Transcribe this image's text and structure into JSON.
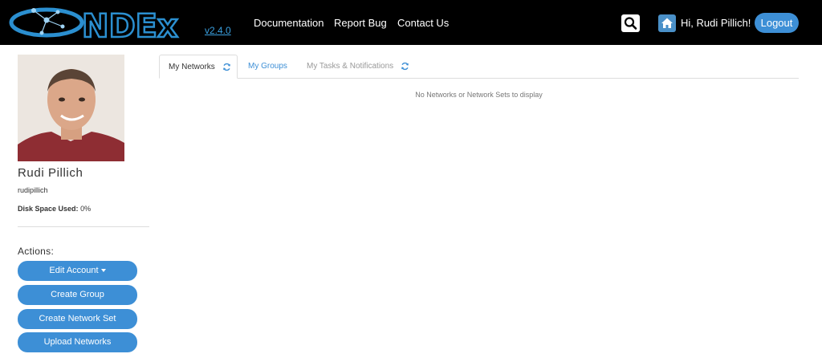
{
  "brand": {
    "logo_text": "NDEx",
    "version": "v2.4.0"
  },
  "nav": {
    "documentation": "Documentation",
    "report_bug": "Report Bug",
    "contact_us": "Contact Us",
    "search_icon": "search-icon",
    "home_icon": "home-icon",
    "greeting": "Hi, Rudi Pillich!",
    "logout": "Logout"
  },
  "profile": {
    "name": "Rudi Pillich",
    "username": "rudipillich",
    "disk_label": "Disk Space Used:",
    "disk_value": "0%"
  },
  "actions": {
    "title": "Actions:",
    "edit_account": "Edit Account",
    "create_group": "Create Group",
    "create_network_set": "Create Network Set",
    "upload_networks": "Upload Networks"
  },
  "tabs": {
    "my_networks": "My Networks",
    "my_groups": "My Groups",
    "my_tasks": "My Tasks & Notifications"
  },
  "content": {
    "empty_message": "No Networks or Network Sets to display"
  },
  "colors": {
    "accent": "#3d8fd6",
    "navbar": "#000000",
    "logo": "#2b8fd0"
  }
}
